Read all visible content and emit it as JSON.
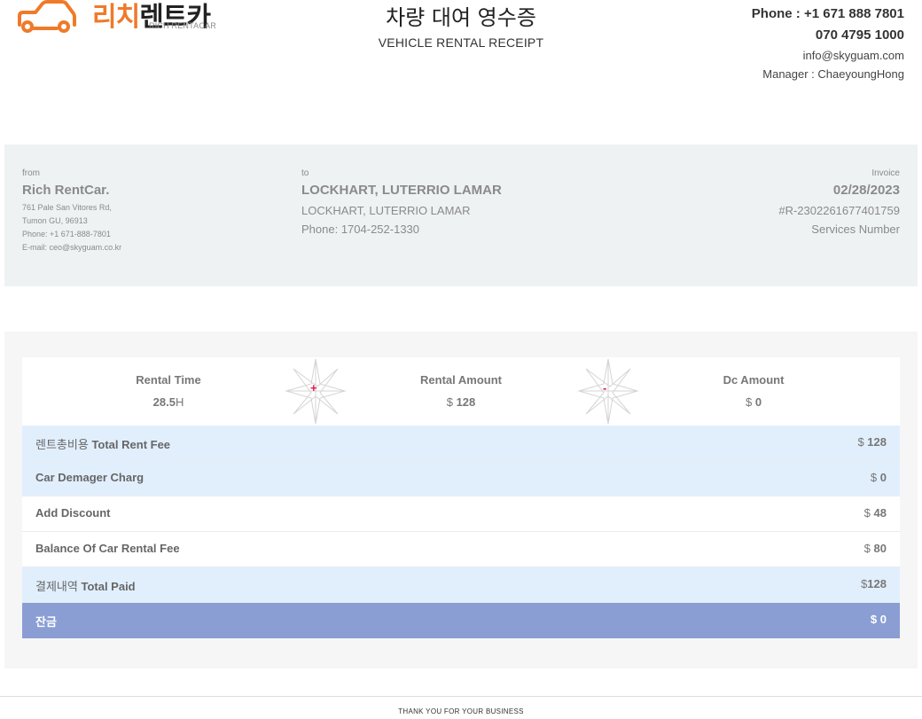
{
  "logo": {
    "name_ko_orange": "리치",
    "name_ko_dark": "렌트카",
    "name_en": "RICH RENTACAR",
    "brand_color": "#ef7a2a"
  },
  "header": {
    "title_ko": "차량 대여 영수증",
    "title_en": "VEHICLE RENTAL RECEIPT"
  },
  "contact": {
    "phone": "Phone : +1 671 888 7801",
    "phone2": "070 4795 1000",
    "email": "info@skyguam.com",
    "manager": "Manager : ChaeyoungHong"
  },
  "from": {
    "label": "from",
    "company": "Rich RentCar.",
    "address1": "761 Pale San Vitores Rd,",
    "address2": "Tumon GU, 96913",
    "phone": "Phone: +1 671-888-7801",
    "email": "E-mail: ceo@skyguam.co.kr"
  },
  "to": {
    "label": "to",
    "name": "LOCKHART, LUTERRIO LAMAR",
    "name2": "LOCKHART, LUTERRIO LAMAR",
    "phone": "Phone: 1704-252-1330"
  },
  "invoice": {
    "label": "Invoice",
    "date": "02/28/2023",
    "number": "#R-2302261677401759",
    "services": "Services Number"
  },
  "summary": {
    "rental_time_label": "Rental Time",
    "rental_time_value": "28.5",
    "rental_time_unit": "H",
    "plus": "+",
    "rental_amount_label": "Rental Amount",
    "rental_amount_currency": "$",
    "rental_amount_value": "128",
    "minus": "-",
    "dc_amount_label": "Dc Amount",
    "dc_amount_currency": "$",
    "dc_amount_value": "0"
  },
  "rows": [
    {
      "label_ko": "렌트총비용",
      "label_en": "Total Rent Fee",
      "currency": "$",
      "value": "128"
    },
    {
      "label_ko": "",
      "label_en": "Car Demager Charg",
      "currency": "$",
      "value": "0"
    },
    {
      "label_ko": "",
      "label_en": "Add Discount",
      "currency": "$",
      "value": "48"
    },
    {
      "label_ko": "",
      "label_en": "Balance Of Car Rental Fee",
      "currency": "$",
      "value": "80"
    },
    {
      "label_ko": "결제내역",
      "label_en": "Total Paid",
      "currency": "$",
      "value": "128"
    },
    {
      "label_ko": "잔금",
      "label_en": "",
      "currency": "$",
      "value": "0"
    }
  ],
  "footer": {
    "text": "THANK YOU FOR YOUR BUSINESS"
  }
}
